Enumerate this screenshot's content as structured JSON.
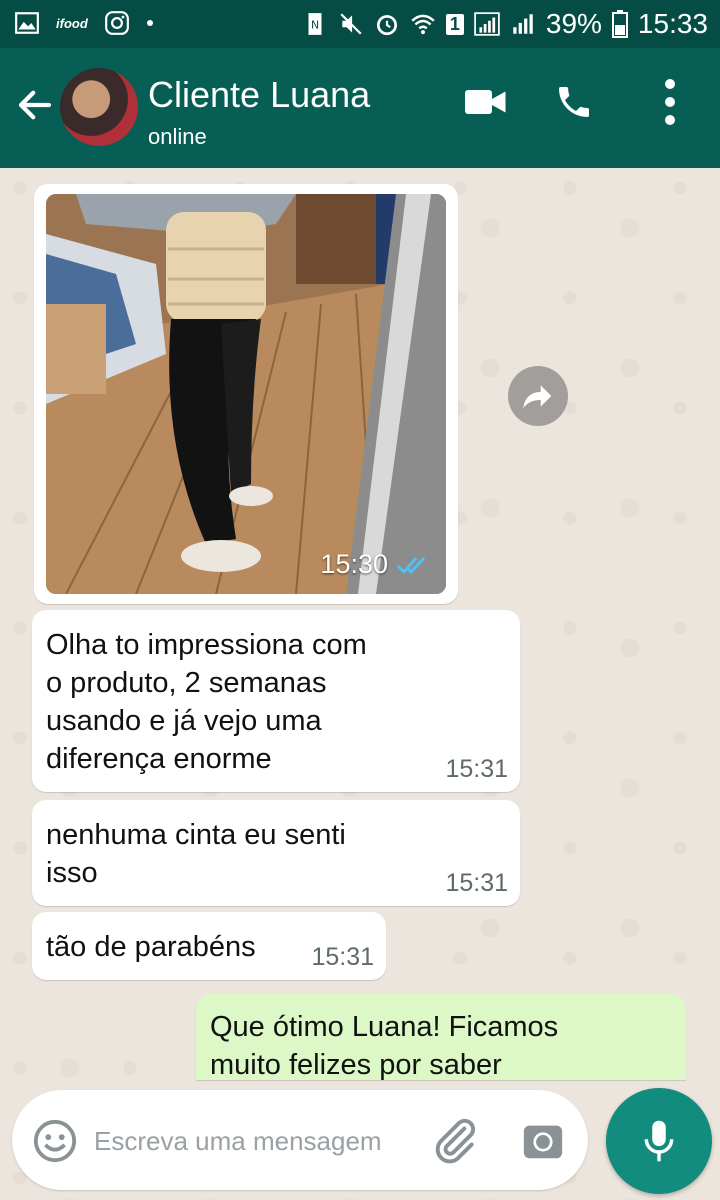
{
  "status_bar": {
    "battery_percent": "39%",
    "time": "15:33",
    "sim_slot": "1",
    "icons": [
      "gallery-icon",
      "ifood-icon",
      "instagram-icon",
      "dot-icon",
      "nfc-icon",
      "mute-icon",
      "alarm-icon",
      "wifi-icon",
      "signal-icon",
      "battery-icon"
    ],
    "ifood_label": "ifood"
  },
  "header": {
    "contact_name": "Cliente Luana",
    "status": "online",
    "icons": [
      "back-arrow-icon",
      "video-call-icon",
      "phone-icon",
      "more-options-icon"
    ]
  },
  "messages": [
    {
      "type": "image",
      "direction": "incoming",
      "time": "15:30",
      "ticks": "read"
    },
    {
      "type": "text",
      "direction": "incoming",
      "lines": [
        "Olha to impressiona com",
        "o produto, 2 semanas",
        "usando e já vejo uma",
        "diferença enorme"
      ],
      "time": "15:31"
    },
    {
      "type": "text",
      "direction": "incoming",
      "lines": [
        "nenhuma cinta eu senti",
        "isso"
      ],
      "time": "15:31"
    },
    {
      "type": "text",
      "direction": "incoming",
      "lines": [
        "tão de parabéns"
      ],
      "time": "15:31"
    },
    {
      "type": "text",
      "direction": "outgoing",
      "lines": [
        "Que ótimo Luana! Ficamos",
        "muito felizes por saber"
      ]
    }
  ],
  "input": {
    "placeholder": "Escreva uma mensagem",
    "value": ""
  },
  "colors": {
    "header": "#075e54",
    "status_bar": "#054d44",
    "incoming_bubble": "#ffffff",
    "outgoing_bubble": "#dcf8c6",
    "mic_button": "#128c7e",
    "read_ticks": "#4fc3f7",
    "chat_background": "#ece5dd"
  }
}
